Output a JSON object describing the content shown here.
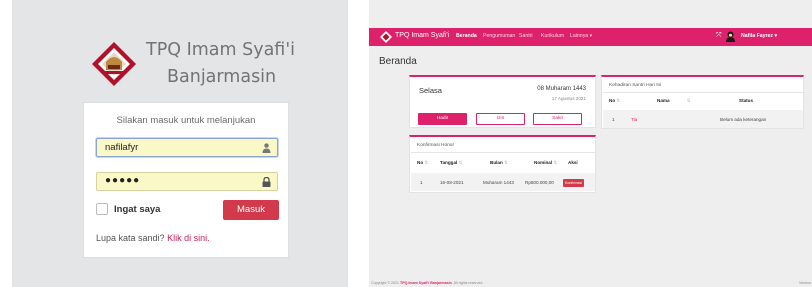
{
  "login": {
    "brand_line1": "TPQ Imam Syafi'i",
    "brand_line2": "Banjarmasin",
    "hint": "Silakan masuk untuk melanjukan",
    "username_value": "nafilafyr",
    "password_value": "●●●●●",
    "remember_label": "Ingat saya",
    "submit_label": "Masuk",
    "forgot_text": "Lupa kata sandi?",
    "forgot_link": "Klik di sini.",
    "colors": {
      "accent": "#d2394a",
      "link": "#c41f56",
      "autofill": "#faf8c6"
    }
  },
  "dashboard": {
    "brand": "TPQ Imam Syafi'i",
    "nav": [
      "Beranda",
      "Pengumuman",
      "Santri",
      "Kurikulum",
      "Lainnya ▾"
    ],
    "user": "Nafila Fayrez ▾",
    "page_title": "Beranda",
    "today": {
      "day": "Selasa",
      "hijri_date": "08 Muharam 1443",
      "masehi_date": "17 Agustus 2021",
      "buttons": [
        "Hadir",
        "Izin",
        "Sakit"
      ]
    },
    "honor": {
      "title": "Konfirmasi Honor",
      "columns": [
        "No",
        "Tanggal",
        "Bulan",
        "Nominal",
        "Aksi"
      ],
      "rows": [
        {
          "no": "1",
          "tanggal": "16-08-2021",
          "bulan": "Muharam 1443",
          "nominal": "Rp500.000,00",
          "aksi": "Konfirmasi"
        }
      ]
    },
    "kehadiran": {
      "title": "Kehadiran Santri Hari Ini",
      "columns": [
        "No",
        "Nama",
        "Status"
      ],
      "rows": [
        {
          "no": "1",
          "nama": "Tia",
          "status": "Belum ada keterangan"
        }
      ]
    },
    "footer": {
      "prefix": "Copyright © 2021",
      "brand": "TPQ Imam Syafi'i Banjarmasin",
      "suffix": ". All rights reserved.",
      "version": "Version"
    },
    "colors": {
      "primary": "#dd216b",
      "danger": "#d2394a"
    }
  }
}
